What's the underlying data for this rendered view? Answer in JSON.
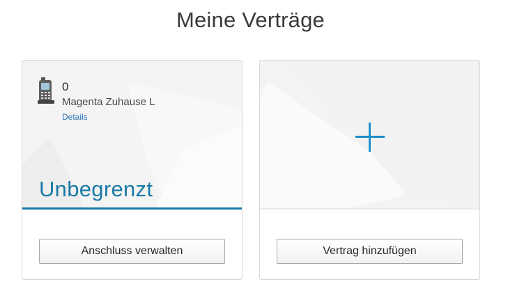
{
  "page": {
    "title": "Meine Verträge"
  },
  "contract_card": {
    "number": "0",
    "tariff_name": "Magenta Zuhause L",
    "details_link": "Details",
    "status_label": "Unbegrenzt",
    "manage_button": "Anschluss verwalten",
    "icon": "landline-phone-icon"
  },
  "add_card": {
    "icon": "plus-icon",
    "add_button": "Vertrag hinzufügen"
  },
  "colors": {
    "accent": "#1a7aa6",
    "plus": "#1d8fcc",
    "link": "#2a73b5"
  }
}
